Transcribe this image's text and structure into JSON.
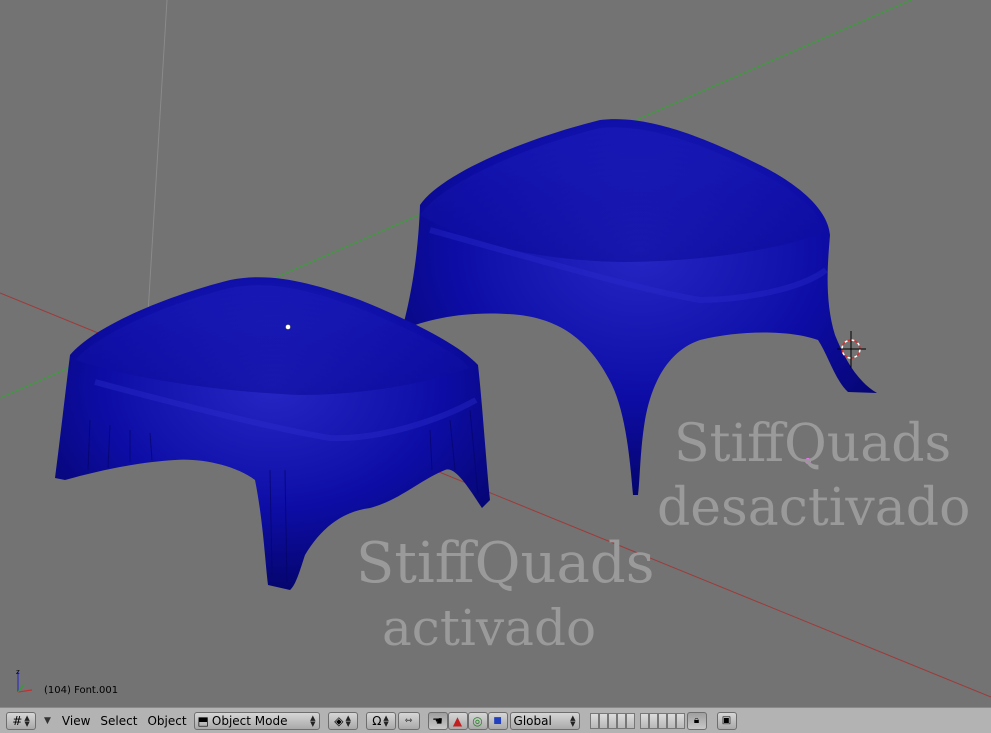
{
  "viewport": {
    "status": "(104) Font.001",
    "label_left": {
      "line1": "StiffQuads",
      "line2": "activado"
    },
    "label_right": {
      "line1": "StiffQuads",
      "line2": "desactivado"
    },
    "colors": {
      "background": "#737373",
      "cloth": "#0c0c9e",
      "text3d": "#9a9a9a",
      "x_axis": "#9e3a3a",
      "y_axis": "#3a9e3a"
    }
  },
  "header": {
    "editor_icon": "viewport-grid-icon",
    "menus": {
      "view": "View",
      "select": "Select",
      "object": "Object"
    },
    "mode": {
      "icon": "object-mode-icon",
      "value": "Object Mode"
    },
    "pivot_icon": "pivot-icon",
    "magnet_icon": "magnet-icon",
    "snap_icon": "snap-icon",
    "manipulators": [
      "hand-icon",
      "translate-icon",
      "rotate-icon",
      "scale-icon"
    ],
    "orientation": "Global",
    "lock_icon": "lock-icon",
    "render_icon": "render-icon"
  }
}
